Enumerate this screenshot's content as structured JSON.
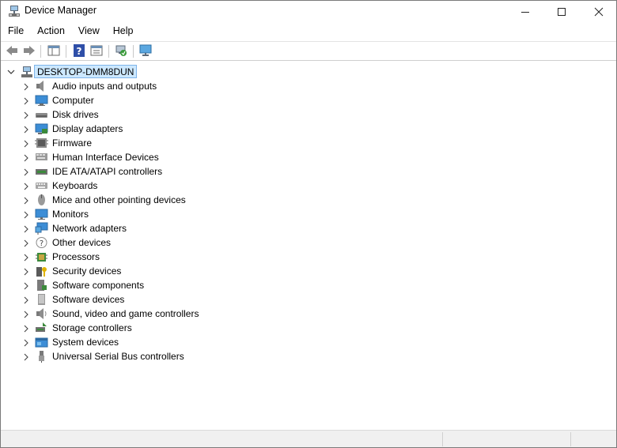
{
  "window": {
    "title": "Device Manager",
    "icon": "device-manager-icon"
  },
  "menu": [
    "File",
    "Action",
    "View",
    "Help"
  ],
  "toolbar": {
    "buttons": [
      "back-arrow-icon",
      "forward-arrow-icon",
      "show-hide-console-tree-icon",
      "help-icon",
      "properties-icon",
      "scan-hardware-icon",
      "monitor-icon"
    ]
  },
  "tree": {
    "root": "DESKTOP-DMM8DUN",
    "categories": [
      {
        "label": "Audio inputs and outputs",
        "icon": "speaker-icon"
      },
      {
        "label": "Computer",
        "icon": "computer-icon"
      },
      {
        "label": "Disk drives",
        "icon": "disk-drive-icon"
      },
      {
        "label": "Display adapters",
        "icon": "display-adapter-icon"
      },
      {
        "label": "Firmware",
        "icon": "firmware-icon"
      },
      {
        "label": "Human Interface Devices",
        "icon": "hid-icon"
      },
      {
        "label": "IDE ATA/ATAPI controllers",
        "icon": "ide-controller-icon"
      },
      {
        "label": "Keyboards",
        "icon": "keyboard-icon"
      },
      {
        "label": "Mice and other pointing devices",
        "icon": "mouse-icon"
      },
      {
        "label": "Monitors",
        "icon": "monitor-icon"
      },
      {
        "label": "Network adapters",
        "icon": "network-adapter-icon"
      },
      {
        "label": "Other devices",
        "icon": "unknown-device-icon"
      },
      {
        "label": "Processors",
        "icon": "processor-icon"
      },
      {
        "label": "Security devices",
        "icon": "security-device-icon"
      },
      {
        "label": "Software components",
        "icon": "software-component-icon"
      },
      {
        "label": "Software devices",
        "icon": "software-device-icon"
      },
      {
        "label": "Sound, video and game controllers",
        "icon": "sound-controller-icon"
      },
      {
        "label": "Storage controllers",
        "icon": "storage-controller-icon"
      },
      {
        "label": "System devices",
        "icon": "system-device-icon"
      },
      {
        "label": "Universal Serial Bus controllers",
        "icon": "usb-icon"
      }
    ]
  }
}
